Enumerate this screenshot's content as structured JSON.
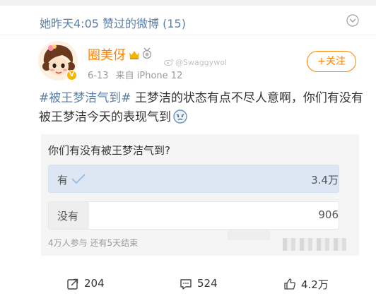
{
  "liked_bar": {
    "text": "她昨天4:05 赞过的微博 (15)",
    "icon": "chevron-down-icon"
  },
  "post": {
    "author": {
      "name": "圈美伢",
      "avatar_icon": "cartoon-girl-avatar",
      "vip_badge": "V"
    },
    "meta": {
      "date": "6-13",
      "source": "来自 iPhone 12"
    },
    "watermark": "@Swaggywol",
    "follow_label": "+关注",
    "topic": "#被王梦洁气到#",
    "body": " 王梦洁的状态有点不尽人意啊，你们有没有被王梦洁今天的表现气到",
    "emoji_icon": "angry-face-icon"
  },
  "poll": {
    "question": "你们有没有被王梦洁气到?",
    "options": [
      {
        "label": "有",
        "count": "3.4万",
        "fill_fraction": 1.0,
        "voted": true
      },
      {
        "label": "没有",
        "count": "906",
        "fill_fraction": 0.14,
        "voted": false
      }
    ],
    "meta": "4万人参与  还有5天结束"
  },
  "actions": {
    "repost": "204",
    "comment": "524",
    "like": "4.2万"
  },
  "colors": {
    "brand_orange": "#ff8200",
    "link_blue": "#5b7fa6",
    "poll_fill": "#dce7f3"
  }
}
